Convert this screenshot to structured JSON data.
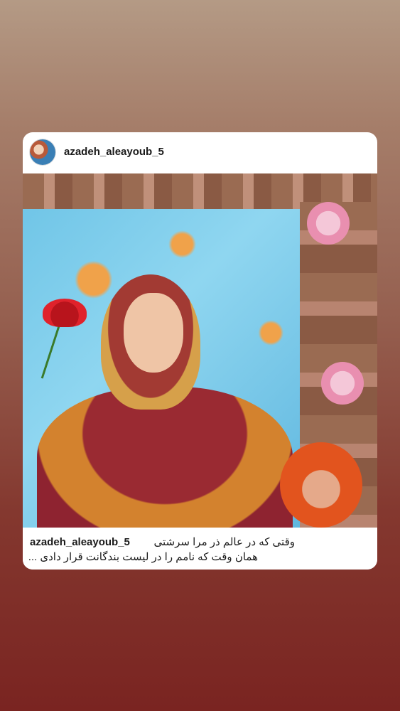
{
  "post": {
    "username": "azadeh_aleayoub_5",
    "avatar_icon": "profile-avatar",
    "photo_description_icon": "post-photo",
    "caption": {
      "username": "azadeh_aleayoub_5",
      "line1": "وقتی که در عالم ذر مرا سرشتی",
      "line2": "همان وقت که نامم را در لیست بندگانت قرار دادی ..."
    }
  },
  "colors": {
    "background_top": "#b49a85",
    "background_bottom": "#7a2421",
    "card": "#ffffff"
  }
}
